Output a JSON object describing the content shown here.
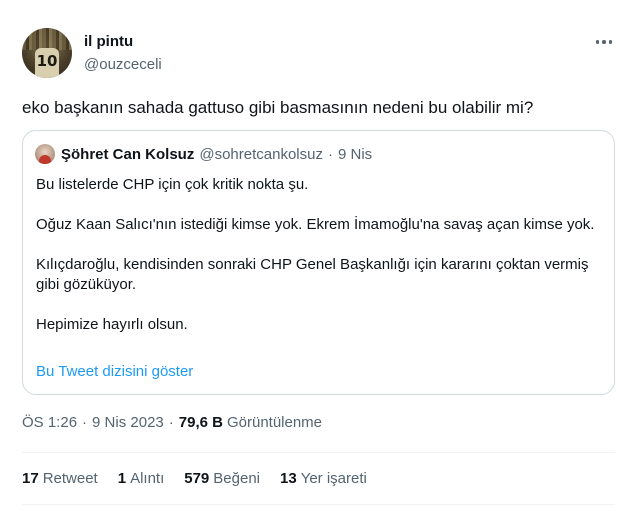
{
  "author": {
    "display_name": "il pintu",
    "handle": "@ouzceceli",
    "avatar_number": "10"
  },
  "tweet": {
    "text": "eko başkanın sahada gattuso gibi basmasının nedeni bu olabilir mi?"
  },
  "quote": {
    "display_name": "Şöhret Can Kolsuz",
    "handle": "@sohretcankolsuz",
    "separator": "·",
    "date": "9 Nis",
    "paragraphs": [
      "Bu listelerde CHP için çok kritik nokta şu.",
      "Oğuz Kaan Salıcı'nın istediği kimse yok. Ekrem İmamoğlu'na savaş açan kimse yok.",
      "Kılıçdaroğlu, kendisinden sonraki CHP Genel Başkanlığı için kararını çoktan vermiş gibi gözüküyor.",
      "Hepimize hayırlı olsun."
    ],
    "show_thread_label": "Bu Tweet dizisini göster"
  },
  "meta": {
    "time": "ÖS 1:26",
    "separator": "·",
    "date": "9 Nis 2023",
    "views_count": "79,6 B",
    "views_label": "Görüntülenme"
  },
  "stats": {
    "retweets": {
      "count": "17",
      "label": "Retweet"
    },
    "quotes": {
      "count": "1",
      "label": "Alıntı"
    },
    "likes": {
      "count": "579",
      "label": "Beğeni"
    },
    "bookmarks": {
      "count": "13",
      "label": "Yer işareti"
    }
  },
  "icons": {
    "more": "more-horizontal-icon"
  },
  "colors": {
    "link": "#1d9bf0",
    "secondary_text": "#536471",
    "primary_text": "#0f1419",
    "border": "#cfd9de"
  }
}
